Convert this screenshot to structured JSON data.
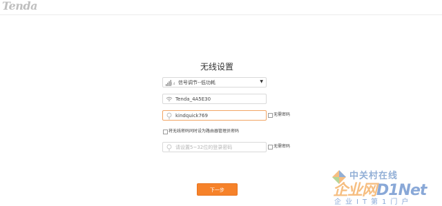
{
  "header": {
    "logo": "Tenda"
  },
  "page": {
    "title": "无线设置"
  },
  "signal": {
    "badge": "2.4",
    "selected": "信号调节--低功耗"
  },
  "ssid": {
    "value": "Tenda_4A5E30"
  },
  "wifi_password": {
    "value": "kindquick769",
    "no_password_label": "无需密码"
  },
  "sync_admin": {
    "label": "将无线密码同时设为路由器管理员密码"
  },
  "admin_password": {
    "placeholder": "请设置5~32位的登录密码",
    "no_password_label": "无需密码"
  },
  "actions": {
    "next_label": "下一步"
  },
  "watermark": {
    "cn": "中关村在线",
    "brand_a": "企业网",
    "brand_b": "D1Net",
    "sub": "企业IT第1门户"
  }
}
